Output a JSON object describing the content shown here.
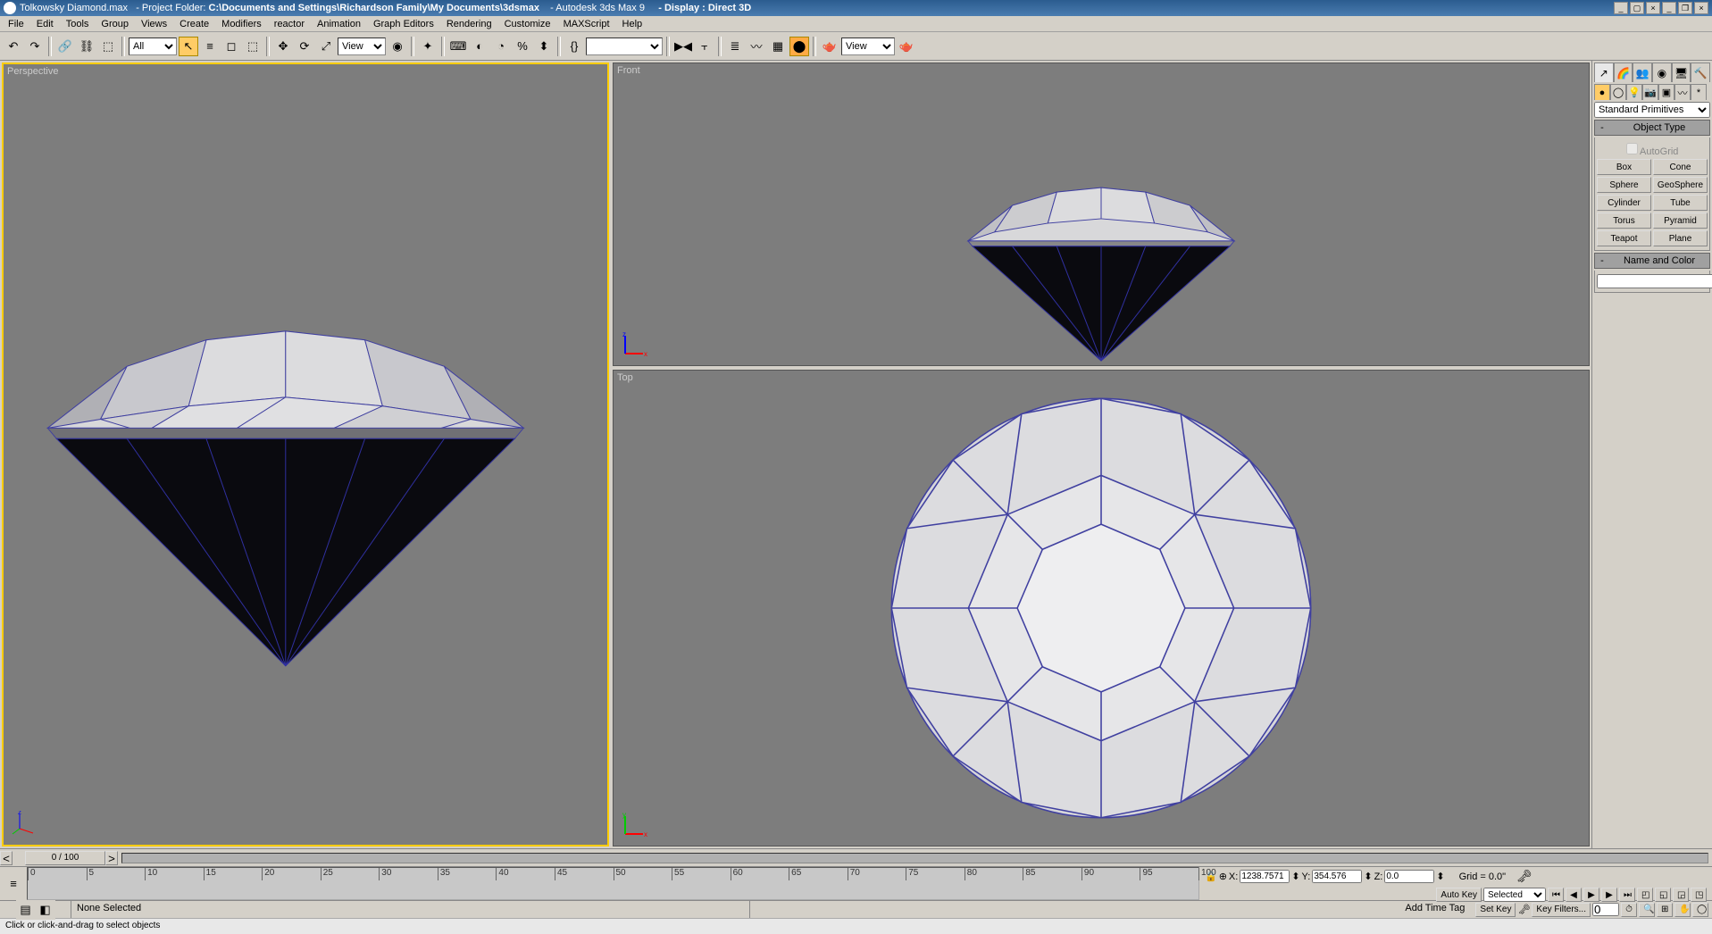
{
  "titlebar": {
    "file": "Tolkowsky Diamond.max",
    "project_label": "   - Project Folder: ",
    "project_path": "C:\\Documents and Settings\\Richardson Family\\My Documents\\3dsmax",
    "app": "    - Autodesk 3ds Max 9 ",
    "display": "    - Display : Direct 3D"
  },
  "menu": [
    "File",
    "Edit",
    "Tools",
    "Group",
    "Views",
    "Create",
    "Modifiers",
    "reactor",
    "Animation",
    "Graph Editors",
    "Rendering",
    "Customize",
    "MAXScript",
    "Help"
  ],
  "toolbar": {
    "filter": "All",
    "view1": "View",
    "view2": "View",
    "named_sel": ""
  },
  "viewports": {
    "front": "Front",
    "top": "Top",
    "perspective": "Perspective"
  },
  "cmd": {
    "dropdown": "Standard Primitives",
    "rollout1": "Object Type",
    "autogrid": "AutoGrid",
    "buttons": [
      "Box",
      "Cone",
      "Sphere",
      "GeoSphere",
      "Cylinder",
      "Tube",
      "Torus",
      "Pyramid",
      "Teapot",
      "Plane"
    ],
    "rollout2": "Name and Color",
    "name_value": ""
  },
  "timeslider": {
    "label": "0 / 100"
  },
  "trackbar": {
    "ticks": [
      0,
      5,
      10,
      15,
      20,
      25,
      30,
      35,
      40,
      45,
      50,
      55,
      60,
      65,
      70,
      75,
      80,
      85,
      90,
      95,
      100
    ]
  },
  "status": {
    "selection": "None Selected",
    "x": "1238.7571",
    "y": "354.576",
    "z": "0.0",
    "grid": "Grid = 0.0\"",
    "autokey": "Auto Key",
    "setkey": "Set Key",
    "selected": "Selected",
    "keyfilters": "Key Filters...",
    "addtag": "Add Time Tag"
  },
  "prompt": {
    "text": "Click or click-and-drag to select objects"
  }
}
